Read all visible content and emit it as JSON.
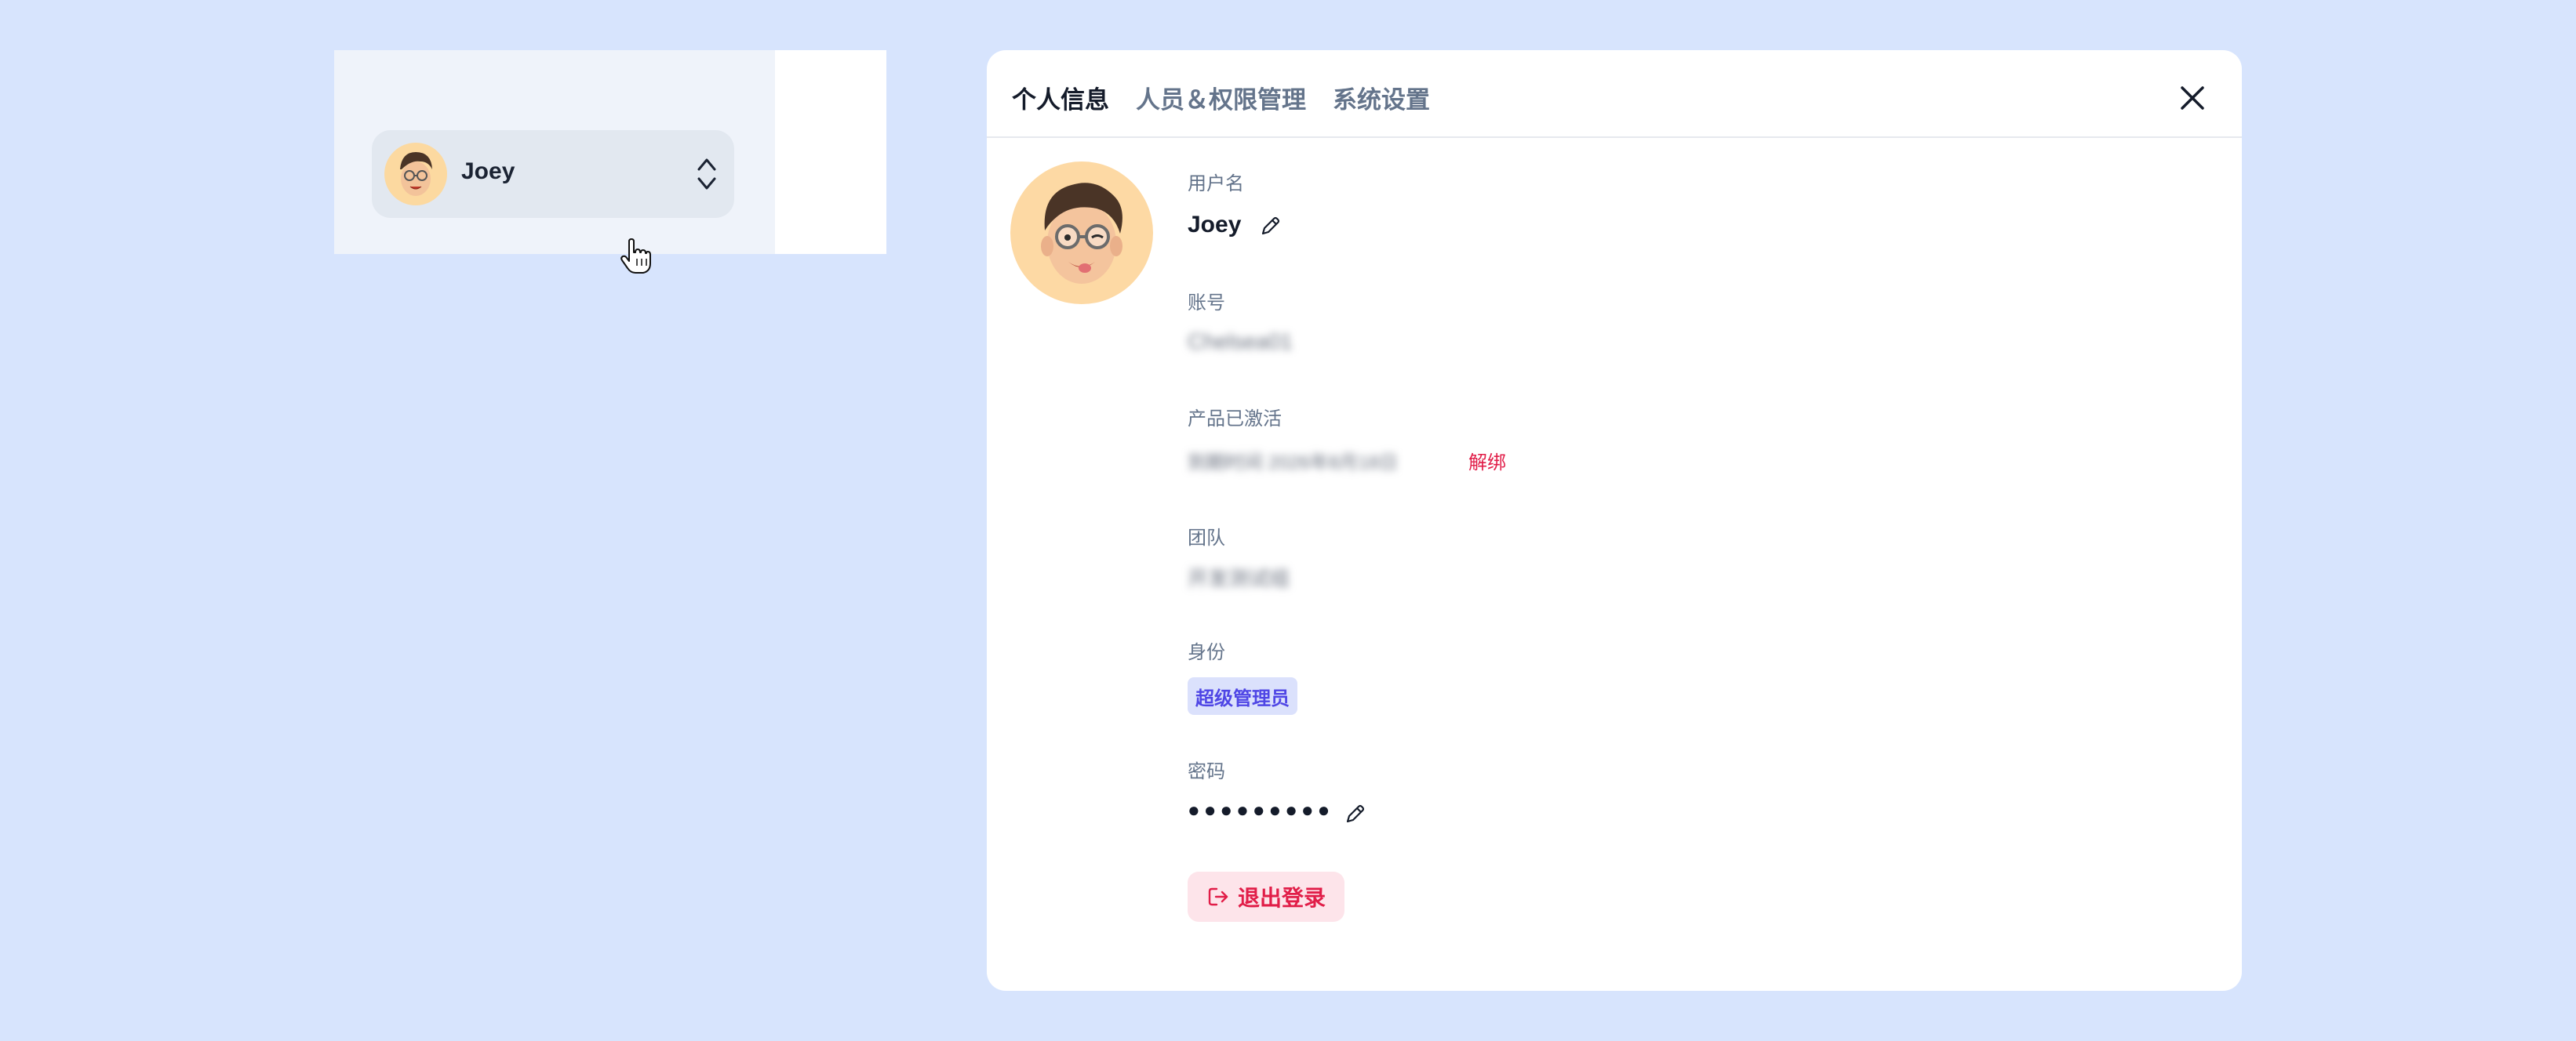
{
  "mini_panel": {
    "user_name": "Joey"
  },
  "dialog": {
    "tabs": [
      {
        "label": "个人信息",
        "active": true
      },
      {
        "label": "人员＆权限管理",
        "active": false
      },
      {
        "label": "系统设置",
        "active": false
      }
    ],
    "fields": {
      "username_label": "用户名",
      "username_value": "Joey",
      "account_label": "账号",
      "account_value": "Chelsea01",
      "product_label": "产品已激活",
      "product_value": "到期时间 2026年8月18日",
      "unbind_label": "解绑",
      "team_label": "团队",
      "team_value": "开发测试组",
      "role_label": "身份",
      "role_value": "超级管理员",
      "password_label": "密码",
      "password_value": "●●●●●●●●●"
    },
    "logout_label": "退出登录"
  },
  "colors": {
    "background": "#d7e4fd",
    "danger": "#e11d48",
    "role_badge_bg": "#dbe1fc",
    "role_badge_text": "#4f46e5",
    "active_tab": "#141b2a",
    "inactive_tab": "#64748b"
  },
  "icons": {
    "close": "close-icon",
    "edit": "pencil-icon",
    "logout": "logout-icon",
    "chevron": "chevron-up-down-icon",
    "cursor": "hand-pointer-icon"
  }
}
